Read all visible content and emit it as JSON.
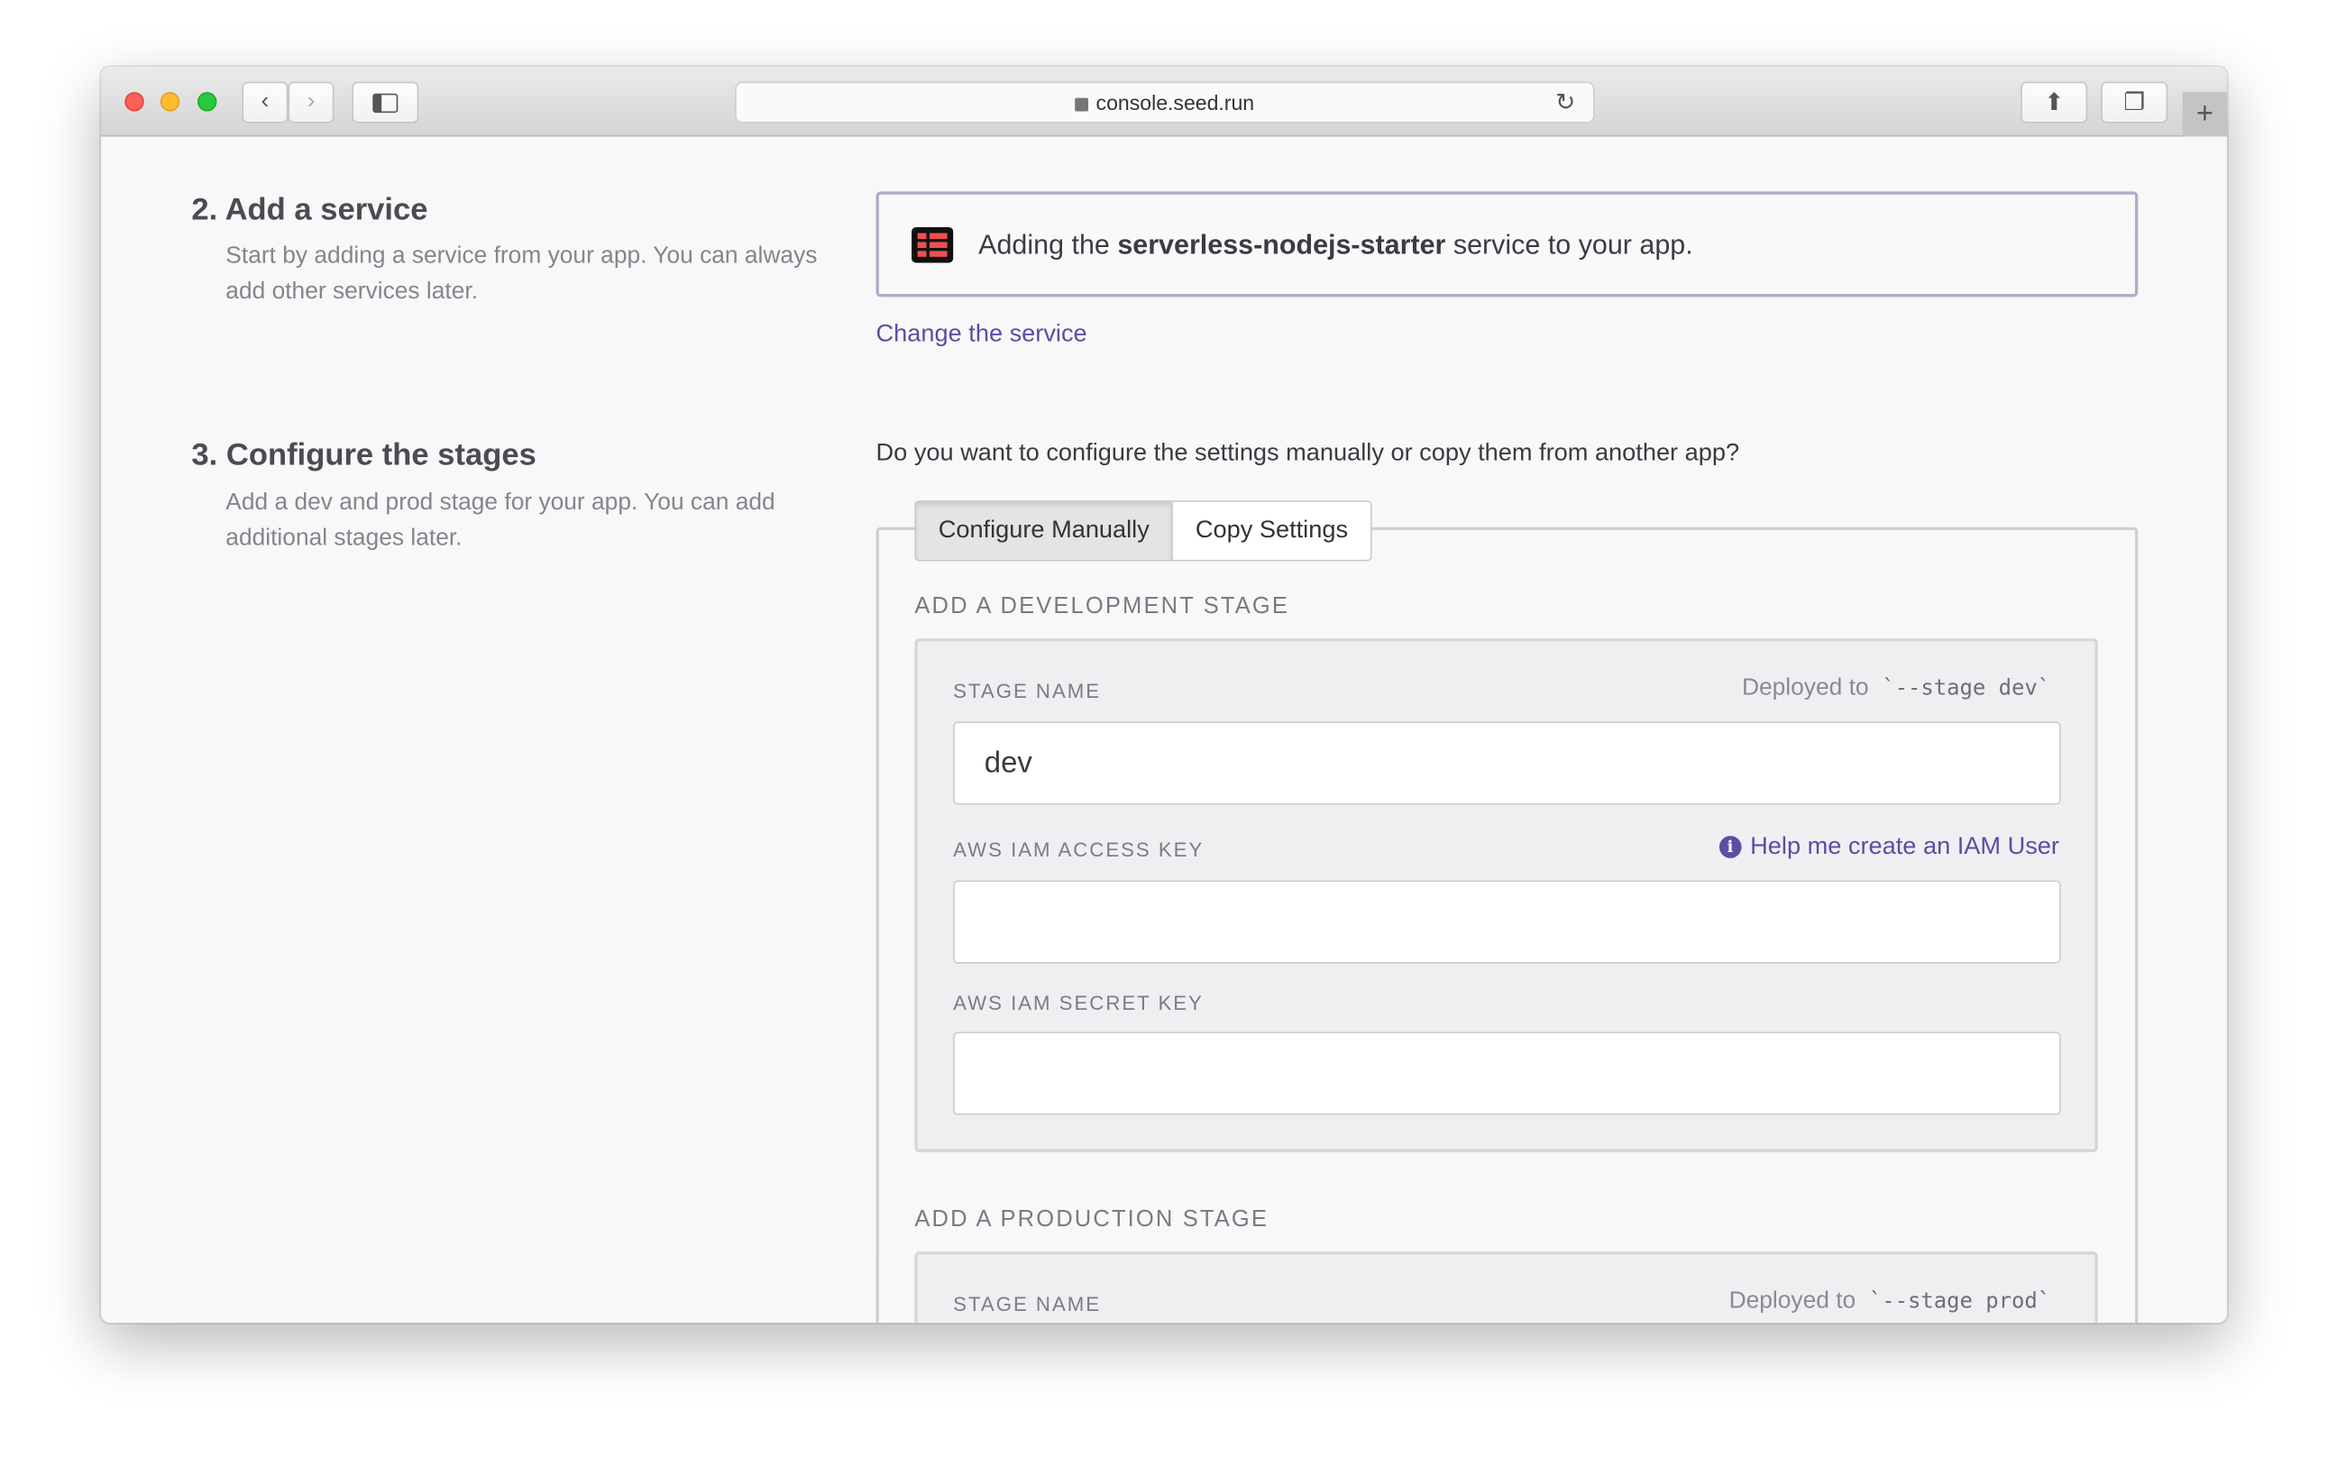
{
  "browser": {
    "url": "console.seed.run",
    "icons": [
      "back-icon",
      "forward-icon",
      "sidebar-icon",
      "lock-icon",
      "reload-icon",
      "share-icon",
      "tabs-icon",
      "new-tab-icon"
    ]
  },
  "step2": {
    "title": "2. Add a service",
    "description": "Start by adding a service from your app. You can always add other services later.",
    "notice_prefix": "Adding the ",
    "service_name": "serverless-nodejs-starter",
    "notice_suffix": " service to your app.",
    "change_link": "Change the service"
  },
  "step3": {
    "title": "3. Configure the stages",
    "description": "Add a dev and prod stage for your app. You can add additional stages later.",
    "question": "Do you want to configure the settings manually or copy them from another app?",
    "tabs": [
      {
        "label": "Configure Manually",
        "active": true
      },
      {
        "label": "Copy Settings",
        "active": false
      }
    ],
    "dev": {
      "heading": "ADD A DEVELOPMENT STAGE",
      "stage_label": "STAGE NAME",
      "deployed_prefix": "Deployed to",
      "deployed_code": "`--stage dev`",
      "stage_value": "dev",
      "access_label": "AWS IAM ACCESS KEY",
      "help_link": "Help me create an IAM User",
      "access_value": "",
      "secret_label": "AWS IAM SECRET KEY",
      "secret_value": ""
    },
    "prod": {
      "heading": "ADD A PRODUCTION STAGE",
      "stage_label": "STAGE NAME",
      "deployed_prefix": "Deployed to",
      "deployed_code": "`--stage prod`"
    }
  },
  "colors": {
    "accent": "#5b4ea3",
    "notice_border": "#b2abc9"
  }
}
